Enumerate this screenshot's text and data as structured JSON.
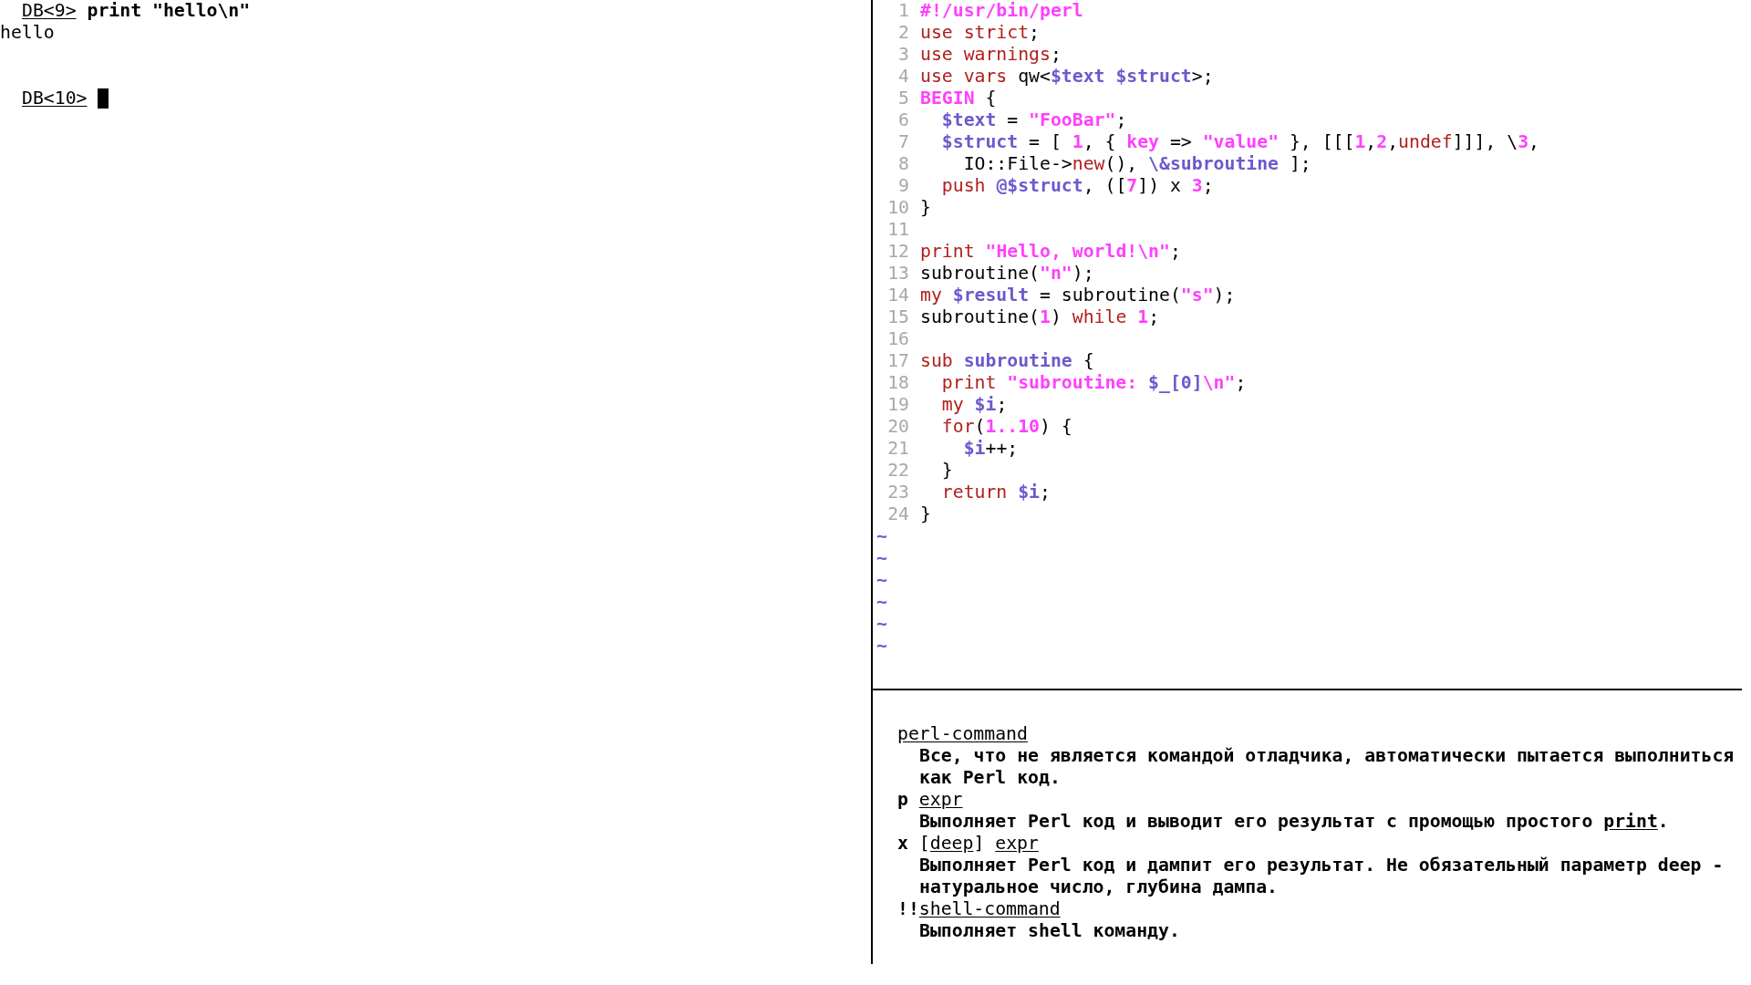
{
  "terminal": {
    "lines": [
      {
        "kind": "prompt",
        "prompt": "DB<9>",
        "command": "print \"hello\\n\""
      },
      {
        "kind": "output",
        "text": "hello"
      },
      {
        "kind": "blank"
      },
      {
        "kind": "blank"
      },
      {
        "kind": "prompt",
        "prompt": "DB<10>",
        "cursor": true
      }
    ]
  },
  "editor": {
    "lines": [
      {
        "number": "1",
        "tokens": [
          {
            "kind": "constant",
            "text": "#!/usr/bin/perl"
          }
        ]
      },
      {
        "number": "2",
        "tokens": [
          {
            "kind": "statement",
            "text": "use strict"
          },
          {
            "kind": "plain",
            "text": ";"
          }
        ]
      },
      {
        "number": "3",
        "tokens": [
          {
            "kind": "statement",
            "text": "use warnings"
          },
          {
            "kind": "plain",
            "text": ";"
          }
        ]
      },
      {
        "number": "4",
        "tokens": [
          {
            "kind": "statement",
            "text": "use vars"
          },
          {
            "kind": "plain",
            "text": " qw<"
          },
          {
            "kind": "identifier",
            "text": "$text $struct"
          },
          {
            "kind": "plain",
            "text": ">;"
          }
        ]
      },
      {
        "number": "5",
        "tokens": [
          {
            "kind": "constant",
            "text": "BEGIN"
          },
          {
            "kind": "plain",
            "text": " {"
          }
        ]
      },
      {
        "number": "6",
        "tokens": [
          {
            "kind": "identifier",
            "text": "  $text"
          },
          {
            "kind": "plain",
            "text": " = "
          },
          {
            "kind": "constant",
            "text": "\"FooBar\""
          },
          {
            "kind": "plain",
            "text": ";"
          }
        ]
      },
      {
        "number": "7",
        "tokens": [
          {
            "kind": "identifier",
            "text": "  $struct"
          },
          {
            "kind": "plain",
            "text": " = [ "
          },
          {
            "kind": "constant",
            "text": "1"
          },
          {
            "kind": "plain",
            "text": ", { "
          },
          {
            "kind": "constant",
            "text": "key"
          },
          {
            "kind": "plain",
            "text": " => "
          },
          {
            "kind": "constant",
            "text": "\"value\""
          },
          {
            "kind": "plain",
            "text": " }, [[["
          },
          {
            "kind": "constant",
            "text": "1"
          },
          {
            "kind": "plain",
            "text": ","
          },
          {
            "kind": "constant",
            "text": "2"
          },
          {
            "kind": "plain",
            "text": ","
          },
          {
            "kind": "statement",
            "text": "undef"
          },
          {
            "kind": "plain",
            "text": "]]], \\"
          },
          {
            "kind": "constant",
            "text": "3"
          },
          {
            "kind": "plain",
            "text": ","
          }
        ]
      },
      {
        "number": "8",
        "tokens": [
          {
            "kind": "plain",
            "text": "    IO::File->"
          },
          {
            "kind": "statement",
            "text": "new"
          },
          {
            "kind": "plain",
            "text": "(), "
          },
          {
            "kind": "identifier",
            "text": "\\&subroutine"
          },
          {
            "kind": "plain",
            "text": " ];"
          }
        ]
      },
      {
        "number": "9",
        "tokens": [
          {
            "kind": "statement",
            "text": "  push "
          },
          {
            "kind": "identifier",
            "text": "@$struct"
          },
          {
            "kind": "plain",
            "text": ", (["
          },
          {
            "kind": "constant",
            "text": "7"
          },
          {
            "kind": "plain",
            "text": "]) x "
          },
          {
            "kind": "constant",
            "text": "3"
          },
          {
            "kind": "plain",
            "text": ";"
          }
        ]
      },
      {
        "number": "10",
        "tokens": [
          {
            "kind": "plain",
            "text": "}"
          }
        ]
      },
      {
        "number": "11"
      },
      {
        "number": "12",
        "tokens": [
          {
            "kind": "statement",
            "text": "print "
          },
          {
            "kind": "constant",
            "text": "\"Hello, world!\\n\""
          },
          {
            "kind": "plain",
            "text": ";"
          }
        ]
      },
      {
        "number": "13",
        "tokens": [
          {
            "kind": "plain",
            "text": "subroutine("
          },
          {
            "kind": "constant",
            "text": "\"n\""
          },
          {
            "kind": "plain",
            "text": ");"
          }
        ]
      },
      {
        "number": "14",
        "tokens": [
          {
            "kind": "statement",
            "text": "my "
          },
          {
            "kind": "identifier",
            "text": "$result"
          },
          {
            "kind": "plain",
            "text": " = subroutine("
          },
          {
            "kind": "constant",
            "text": "\"s\""
          },
          {
            "kind": "plain",
            "text": ");"
          }
        ]
      },
      {
        "number": "15",
        "tokens": [
          {
            "kind": "plain",
            "text": "subroutine("
          },
          {
            "kind": "constant",
            "text": "1"
          },
          {
            "kind": "plain",
            "text": ") "
          },
          {
            "kind": "statement",
            "text": "while "
          },
          {
            "kind": "constant",
            "text": "1"
          },
          {
            "kind": "plain",
            "text": ";"
          }
        ]
      },
      {
        "number": "16"
      },
      {
        "number": "17",
        "tokens": [
          {
            "kind": "statement",
            "text": "sub "
          },
          {
            "kind": "identifier",
            "text": "subroutine"
          },
          {
            "kind": "plain",
            "text": " {"
          }
        ]
      },
      {
        "number": "18",
        "tokens": [
          {
            "kind": "statement",
            "text": "  print "
          },
          {
            "kind": "constant",
            "text": "\"subroutine: "
          },
          {
            "kind": "identifier",
            "text": "$_[0]"
          },
          {
            "kind": "constant",
            "text": "\\n\""
          },
          {
            "kind": "plain",
            "text": ";"
          }
        ]
      },
      {
        "number": "19",
        "tokens": [
          {
            "kind": "statement",
            "text": "  my "
          },
          {
            "kind": "identifier",
            "text": "$i"
          },
          {
            "kind": "plain",
            "text": ";"
          }
        ]
      },
      {
        "number": "20",
        "tokens": [
          {
            "kind": "statement",
            "text": "  for"
          },
          {
            "kind": "plain",
            "text": "("
          },
          {
            "kind": "constant",
            "text": "1..10"
          },
          {
            "kind": "plain",
            "text": ") {"
          }
        ]
      },
      {
        "number": "21",
        "tokens": [
          {
            "kind": "identifier",
            "text": "    $i"
          },
          {
            "kind": "plain",
            "text": "++;"
          }
        ]
      },
      {
        "number": "22",
        "tokens": [
          {
            "kind": "plain",
            "text": "  }"
          }
        ]
      },
      {
        "number": "23",
        "tokens": [
          {
            "kind": "statement",
            "text": "  return "
          },
          {
            "kind": "identifier",
            "text": "$i"
          },
          {
            "kind": "plain",
            "text": ";"
          }
        ]
      },
      {
        "number": "24",
        "tokens": [
          {
            "kind": "plain",
            "text": "}"
          }
        ]
      }
    ],
    "filler": [
      "~",
      "~",
      "~",
      "~",
      "~",
      "~"
    ]
  },
  "help": {
    "entries": [
      {
        "term": [
          {
            "kind": "underline",
            "text": "perl-command"
          }
        ],
        "lines": [
          [
            {
              "kind": "plain",
              "text": "Все, что не является командой отладчика, автоматически пытается выполниться"
            }
          ],
          [
            {
              "kind": "plain",
              "text": "как Perl код."
            }
          ]
        ]
      },
      {
        "term": [
          {
            "kind": "bold",
            "text": "p "
          },
          {
            "kind": "underline",
            "text": "expr"
          }
        ],
        "lines": [
          [
            {
              "kind": "plain",
              "text": "Выполняет Perl код и выводит его результат с промощью простого "
            },
            {
              "kind": "underline",
              "text": "print"
            },
            {
              "kind": "plain",
              "text": "."
            }
          ]
        ]
      },
      {
        "term": [
          {
            "kind": "bold",
            "text": "x"
          },
          {
            "kind": "plain",
            "text": " ["
          },
          {
            "kind": "underline",
            "text": "deep"
          },
          {
            "kind": "plain",
            "text": "] "
          },
          {
            "kind": "underline",
            "text": "expr"
          }
        ],
        "lines": [
          [
            {
              "kind": "plain",
              "text": "Выполняет Perl код и дампит его результат. Не обязательный параметр deep -"
            }
          ],
          [
            {
              "kind": "plain",
              "text": "натуральное число, глубина дампа."
            }
          ]
        ]
      },
      {
        "term": [
          {
            "kind": "bold",
            "text": "!!"
          },
          {
            "kind": "underline",
            "text": "shell-command"
          }
        ],
        "lines": [
          [
            {
              "kind": "plain",
              "text": "Выполняет shell команду."
            }
          ]
        ]
      }
    ]
  }
}
